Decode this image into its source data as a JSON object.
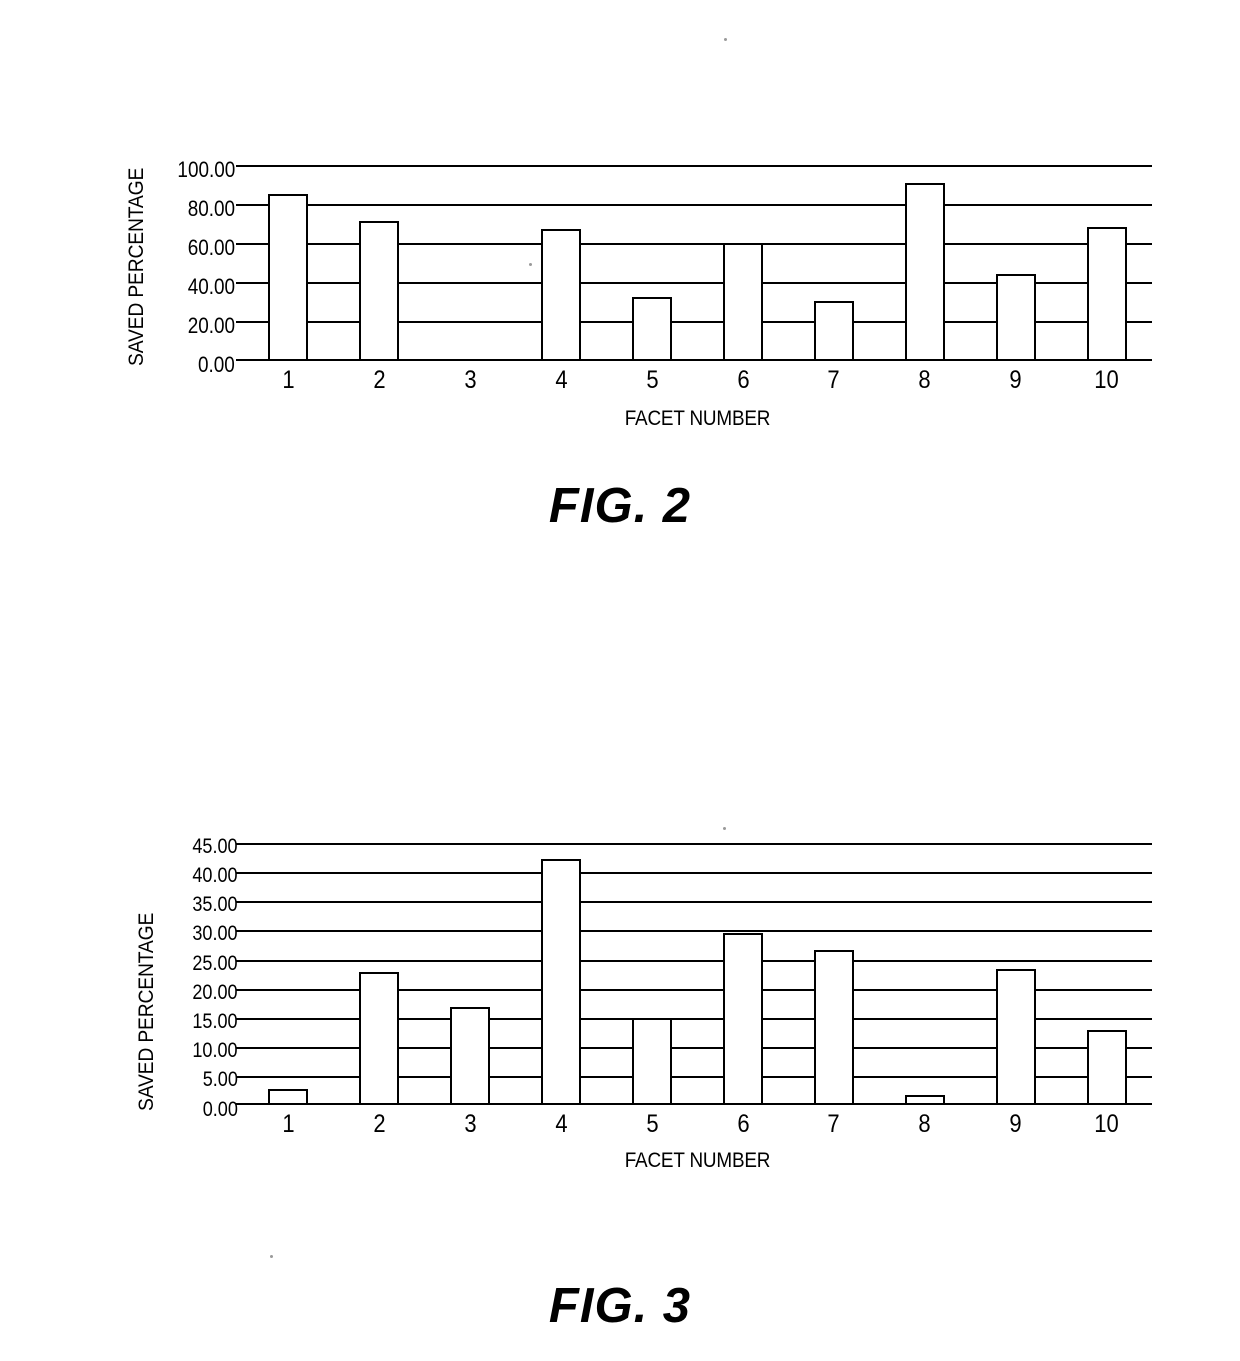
{
  "document": {
    "type": "patent-drawing-sheet",
    "background_color": "#ffffff",
    "ink_color": "#000000"
  },
  "figures": [
    {
      "id": "fig-2",
      "caption": "FIG. 2",
      "chart_data": {
        "type": "bar",
        "title": "",
        "xlabel": "FACET NUMBER",
        "ylabel": "SAVED PERCENTAGE",
        "categories": [
          "1",
          "2",
          "3",
          "4",
          "5",
          "6",
          "7",
          "8",
          "9",
          "10"
        ],
        "values": [
          86.0,
          72.0,
          0.0,
          68.0,
          33.0,
          61.0,
          31.0,
          92.0,
          45.0,
          69.0
        ],
        "ylim": [
          0,
          100
        ],
        "ytick_step": 20,
        "ytick_labels": [
          "100.00",
          "80.00",
          "60.00",
          "40.00",
          "20.00",
          "0.00"
        ],
        "ytick_values": [
          100,
          80,
          60,
          40,
          20,
          0
        ],
        "grid": true,
        "grid_axis": "y",
        "legend": false,
        "bar_fill": "#ffffff",
        "bar_edge": "#000000"
      }
    },
    {
      "id": "fig-3",
      "caption": "FIG. 3",
      "chart_data": {
        "type": "bar",
        "title": "",
        "xlabel": "FACET NUMBER",
        "ylabel": "SAVED PERCENTAGE",
        "categories": [
          "1",
          "2",
          "3",
          "4",
          "5",
          "6",
          "7",
          "8",
          "9",
          "10"
        ],
        "values": [
          2.8,
          23.0,
          17.0,
          42.5,
          15.0,
          29.7,
          26.8,
          1.8,
          23.5,
          13.0
        ],
        "ylim": [
          0,
          45
        ],
        "ytick_step": 5,
        "ytick_labels": [
          "45.00",
          "40.00",
          "35.00",
          "30.00",
          "25.00",
          "20.00",
          "15.00",
          "10.00",
          "5.00",
          "0.00"
        ],
        "ytick_values": [
          45,
          40,
          35,
          30,
          25,
          20,
          15,
          10,
          5,
          0
        ],
        "grid": true,
        "grid_axis": "y",
        "legend": false,
        "bar_fill": "#ffffff",
        "bar_edge": "#000000"
      }
    }
  ]
}
